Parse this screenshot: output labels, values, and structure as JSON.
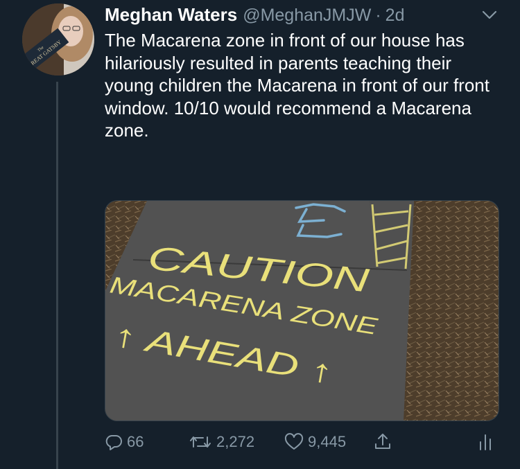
{
  "tweet": {
    "author_name": "Meghan Waters",
    "handle": "@MeghanJMJW",
    "separator": "·",
    "time": "2d",
    "text": "The Macarena zone in front of our house has hilariously resulted in parents teaching their young children the Macarena in front of our front window. 10/10 would recommend a Macarena zone."
  },
  "avatar": {
    "book_title_line1": "The",
    "book_title_line2": "GREAT GATSBY"
  },
  "media": {
    "chalk_line1": "CAUTION",
    "chalk_line2": "MACARENA ZONE",
    "chalk_line3": "↑ AHEAD ↑",
    "chalk_color": "#e9e07a",
    "blue_chalk_color": "#7fb6d9"
  },
  "actions": {
    "reply_count": "66",
    "retweet_count": "2,272",
    "like_count": "9,445"
  },
  "colors": {
    "background": "#15202b",
    "secondary_text": "#8899a6",
    "border": "#38444d"
  }
}
